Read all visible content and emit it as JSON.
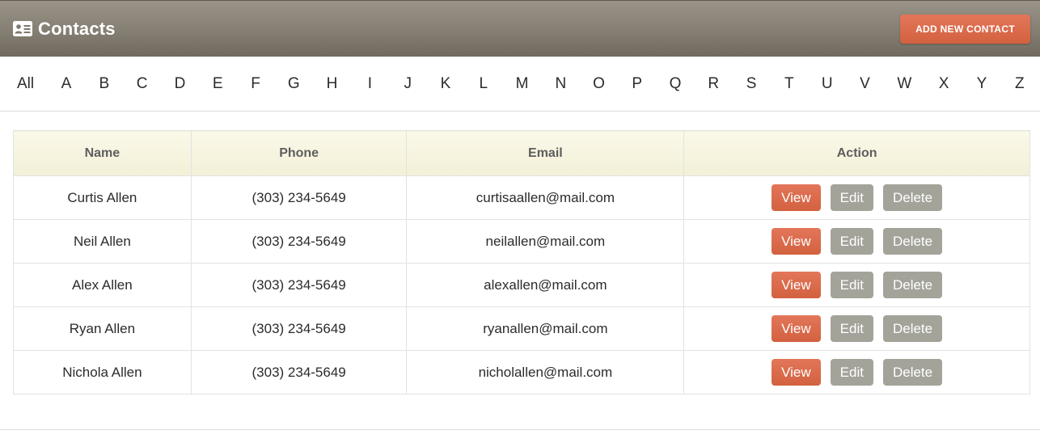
{
  "header": {
    "title": "Contacts",
    "icon": "contact-card-icon",
    "add_button_label": "Add new contact",
    "colors": {
      "bar": "#857e72",
      "accent": "#d96a4a",
      "secondary_button": "#a3a39a"
    }
  },
  "alphabet": [
    "All",
    "A",
    "B",
    "C",
    "D",
    "E",
    "F",
    "G",
    "H",
    "I",
    "J",
    "K",
    "L",
    "M",
    "N",
    "O",
    "P",
    "Q",
    "R",
    "S",
    "T",
    "U",
    "V",
    "W",
    "X",
    "Y",
    "Z"
  ],
  "table": {
    "columns": [
      "Name",
      "Phone",
      "Email",
      "Action"
    ],
    "actions": {
      "view": "View",
      "edit": "Edit",
      "delete": "Delete"
    },
    "rows": [
      {
        "name": "Curtis Allen",
        "phone": "(303) 234-5649",
        "email": "curtisaallen@mail.com"
      },
      {
        "name": "Neil Allen",
        "phone": "(303) 234-5649",
        "email": "neilallen@mail.com"
      },
      {
        "name": "Alex Allen",
        "phone": "(303) 234-5649",
        "email": "alexallen@mail.com"
      },
      {
        "name": "Ryan Allen",
        "phone": "(303) 234-5649",
        "email": "ryanallen@mail.com"
      },
      {
        "name": "Nichola Allen",
        "phone": "(303) 234-5649",
        "email": "nicholallen@mail.com"
      }
    ]
  }
}
